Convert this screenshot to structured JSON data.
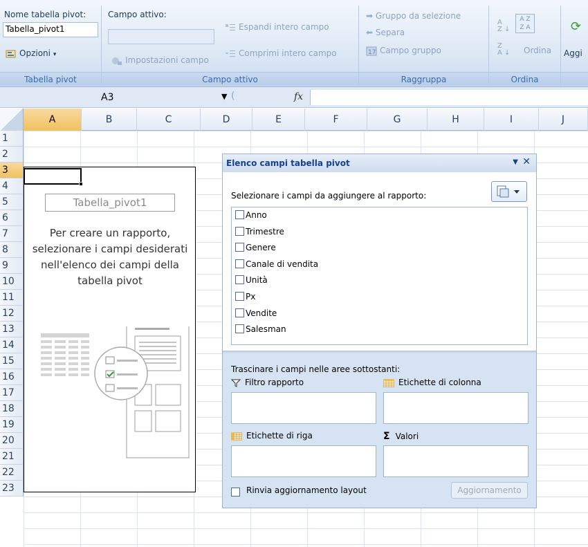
{
  "ribbon": {
    "pivot_table": {
      "name_label": "Nome tabella pivot:",
      "name_value": "Tabella_pivot1",
      "options_label": "Opzioni",
      "group_label": "Tabella pivot"
    },
    "active_field": {
      "label": "Campo attivo:",
      "value": "",
      "settings_label": "Impostazioni campo",
      "expand_label": "Espandi intero campo",
      "collapse_label": "Comprimi intero campo",
      "group_label": "Campo attivo"
    },
    "group": {
      "group_selection": "Gruppo da selezione",
      "ungroup": "Separa",
      "group_field": "Campo gruppo",
      "group_label": "Raggruppa"
    },
    "sort": {
      "sort_label": "Ordina",
      "group_label": "Ordina"
    },
    "data": {
      "refresh_label": "Aggi"
    }
  },
  "formula_bar": {
    "name_box": "A3",
    "fx": "fx",
    "formula": ""
  },
  "sheet": {
    "columns": [
      "A",
      "B",
      "C",
      "D",
      "E",
      "F",
      "G",
      "H",
      "I",
      "J"
    ],
    "rows": [
      "1",
      "2",
      "3",
      "4",
      "5",
      "6",
      "7",
      "8",
      "9",
      "10",
      "11",
      "12",
      "13",
      "14",
      "15",
      "16",
      "17",
      "18",
      "19",
      "20",
      "21",
      "22",
      "23"
    ],
    "selected_column": "A",
    "selected_row": "3"
  },
  "placeholder": {
    "name": "Tabella_pivot1",
    "text": "Per creare un rapporto, selezionare i campi desiderati nell'elenco dei campi della tabella pivot"
  },
  "pane": {
    "title": "Elenco campi tabella pivot",
    "instruction": "Selezionare i campi da aggiungere al rapporto:",
    "fields": [
      "Anno",
      "Trimestre",
      "Genere",
      "Canale di vendita",
      "Unità",
      "Px",
      "Vendite",
      "Salesman"
    ],
    "drag_instruction": "Trascinare i campi nelle aree sottostanti:",
    "report_filter": "Filtro rapporto",
    "column_labels": "Etichette di colonna",
    "row_labels": "Etichette di riga",
    "values": "Valori",
    "defer_label": "Rinvia aggiornamento layout",
    "update_label": "Aggiornamento"
  },
  "colors": {
    "ribbon_bg": "#dde8f5",
    "pane_bg": "#d6e3f3",
    "title_text": "#15428b",
    "selected_header": "#f1c15f"
  }
}
